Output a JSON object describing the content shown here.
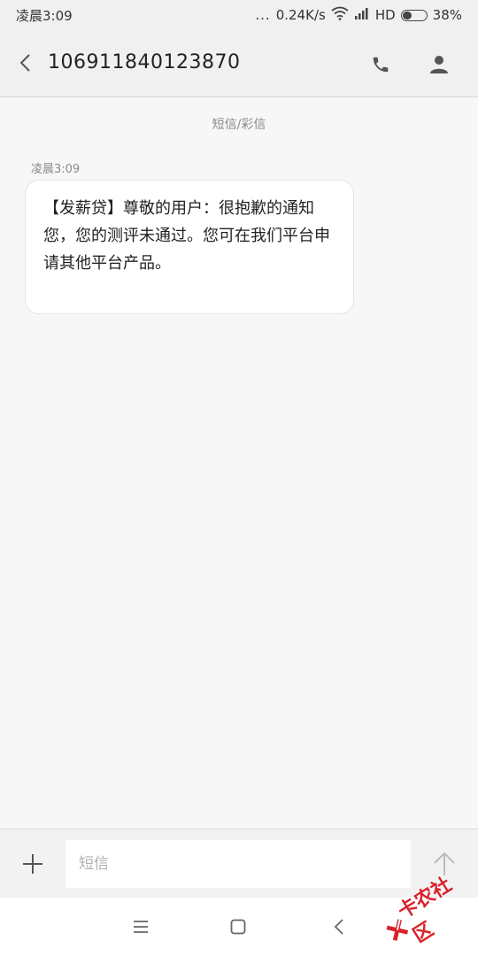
{
  "status_bar": {
    "time": "凌晨3:09",
    "dots": "...",
    "network_speed": "0.24K/s",
    "network_type": "HD",
    "battery_percent": "38%",
    "battery_level": 0.38
  },
  "header": {
    "back_icon": "chevron-left-icon",
    "contact_number": "106911840123870",
    "call_icon": "phone-icon",
    "contact_icon": "person-icon"
  },
  "conversation": {
    "message_type_label": "短信/彩信",
    "messages": [
      {
        "time": "凌晨3:09",
        "text": "【发薪贷】尊敬的用户：很抱歉的通知您，您的测评未通过。您可在我们平台申请其他平台产品。"
      }
    ]
  },
  "composer": {
    "add_icon": "plus-icon",
    "placeholder": "短信",
    "send_icon": "arrow-up-icon"
  },
  "nav_bar": {
    "menu_icon": "menu-icon",
    "home_icon": "square-icon",
    "back_icon": "triangle-back-icon"
  },
  "watermark": {
    "text": "卡农社区",
    "color": "#d9232a"
  }
}
